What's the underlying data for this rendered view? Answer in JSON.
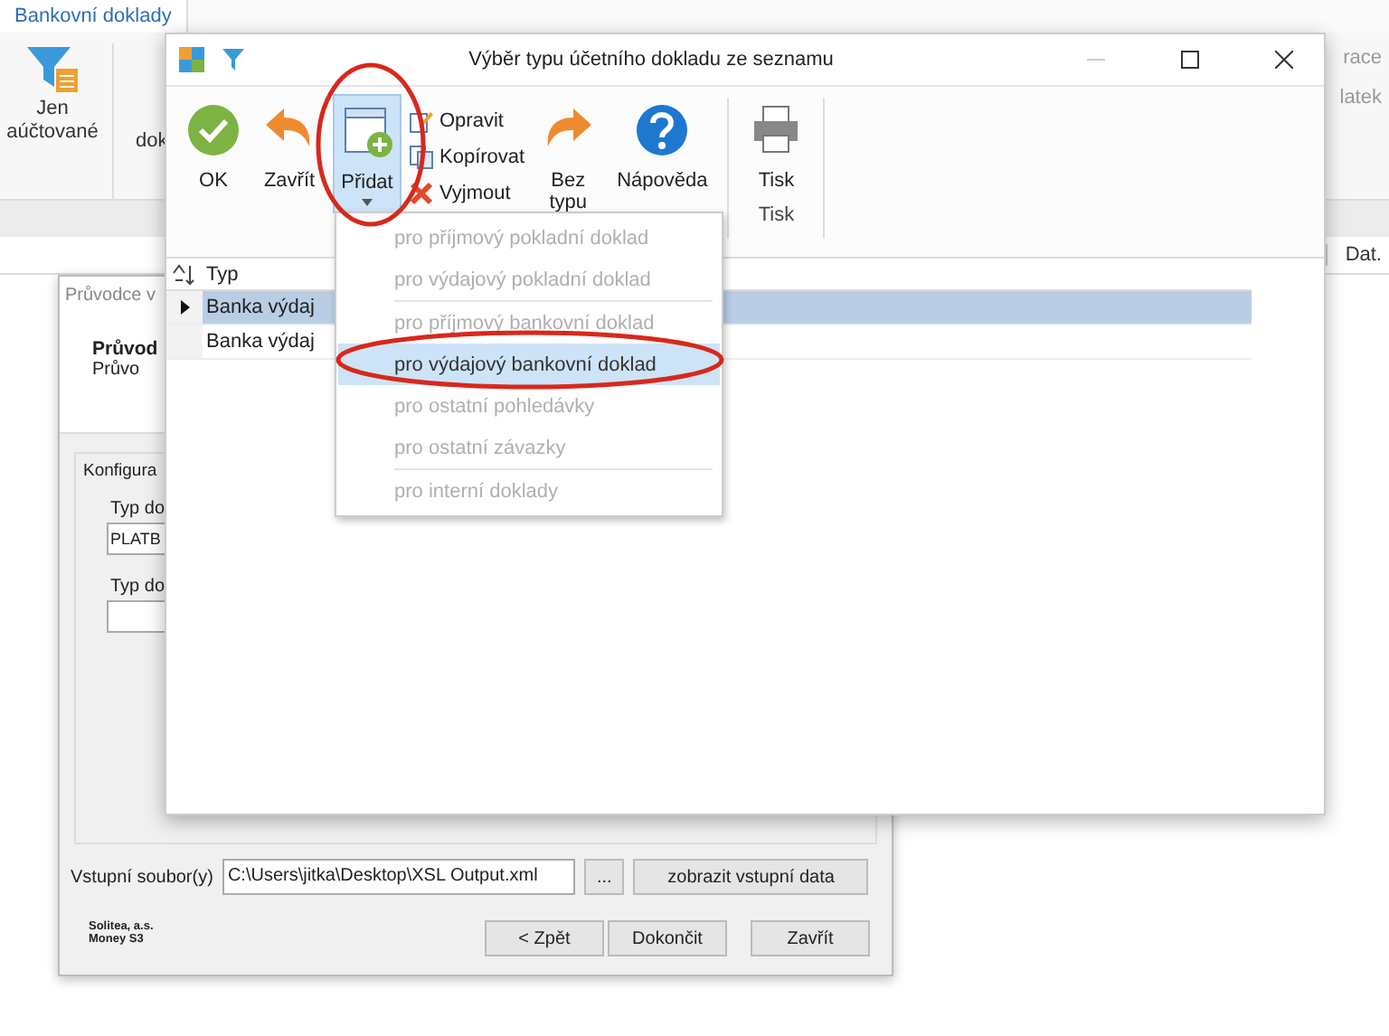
{
  "background_app": {
    "tab": "Bankovní doklady",
    "filter_label": [
      "Jen",
      "aúčtované"
    ],
    "partial_label": "dok",
    "right_labels": [
      "race",
      "latek"
    ],
    "column_header": "Dat."
  },
  "wizard": {
    "title": "Průvodce v",
    "heading": "Průvod",
    "subheading": "Průvo",
    "group_label": "Konfigura",
    "fields": [
      {
        "label": "Typ do",
        "value": "PLATB"
      },
      {
        "label": "Typ do"
      }
    ],
    "input_file": {
      "label": "Vstupní soubor(y)",
      "value": "C:\\Users\\jitka\\Desktop\\XSL Output.xml"
    },
    "browse_button": "...",
    "show_button": "zobrazit vstupní data",
    "vendor": [
      "Solitea, a.s.",
      "Money S3"
    ],
    "buttons": [
      "< Zpět",
      "Dokončit",
      "Zavřít"
    ]
  },
  "dialog": {
    "title": "Výběr typu účetního dokladu ze seznamu",
    "toolbar": {
      "ok": "OK",
      "close": "Zavřít",
      "add": {
        "label": "Přidat",
        "pressed": true
      },
      "small_buttons": [
        "Opravit",
        "Kopírovat",
        "Vyjmout"
      ],
      "no_type": [
        "Bez",
        "typu"
      ],
      "help": "Nápověda",
      "print": "Tisk",
      "print_group": "Tisk"
    },
    "grid": {
      "column": "Typ",
      "rows": [
        {
          "text": "Banka výdaj",
          "selected": true
        },
        {
          "text": "Banka výdaj",
          "selected": false
        }
      ]
    }
  },
  "menu": {
    "items": [
      {
        "label": "pro příjmový pokladní doklad",
        "disabled": true,
        "selected": false,
        "separator_after": false
      },
      {
        "label": "pro výdajový pokladní doklad",
        "disabled": true,
        "selected": false,
        "separator_after": true
      },
      {
        "label": "pro příjmový bankovní doklad",
        "disabled": true,
        "selected": false,
        "separator_after": false
      },
      {
        "label": "pro výdajový bankovní doklad",
        "disabled": false,
        "selected": true,
        "separator_after": false
      },
      {
        "label": "pro ostatní pohledávky",
        "disabled": true,
        "selected": false,
        "separator_after": false
      },
      {
        "label": "pro ostatní závazky",
        "disabled": true,
        "selected": false,
        "separator_after": true
      },
      {
        "label": "pro interní doklady",
        "disabled": true,
        "selected": false,
        "separator_after": false
      }
    ]
  }
}
